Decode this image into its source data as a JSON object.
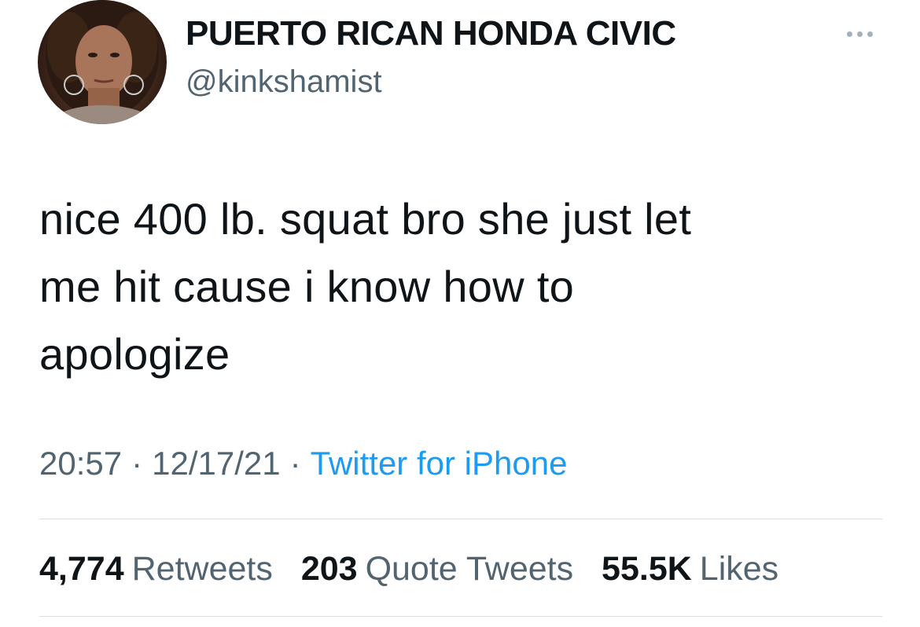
{
  "user": {
    "display_name": "PUERTO RICAN HONDA CIVIC",
    "handle": "@kinkshamist",
    "avatar_icon": "profile-photo"
  },
  "more_icon": "ellipsis-icon",
  "tweet": {
    "lines": [
      "nice 400 lb. squat bro she just let",
      "me hit cause i know how to",
      "apologize"
    ],
    "time": "20:57",
    "date": "12/17/21",
    "separator": "·",
    "source": "Twitter for iPhone"
  },
  "stats": {
    "retweets": {
      "count": "4,774",
      "label": "Retweets"
    },
    "quotes": {
      "count": "203",
      "label": "Quote Tweets"
    },
    "likes": {
      "count": "55.5K",
      "label": "Likes"
    }
  },
  "colors": {
    "text": "#0f1419",
    "secondary": "#536471",
    "link": "#1d9bf0",
    "divider": "#d9dee2"
  }
}
